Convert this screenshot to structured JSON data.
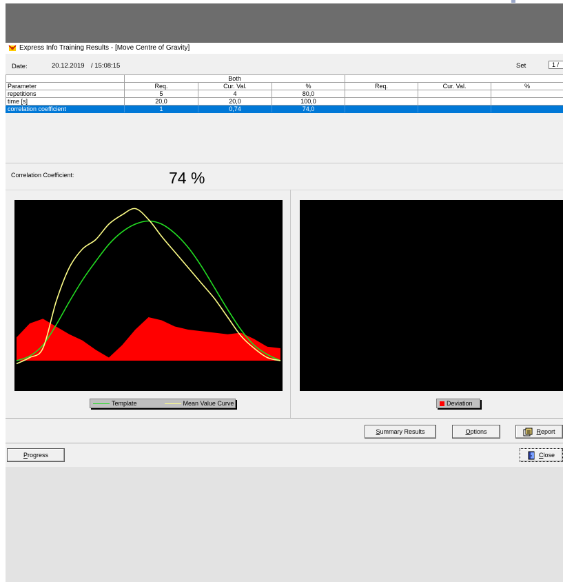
{
  "window": {
    "title": "Express Info Training Results - [Move Centre of Gravity]"
  },
  "info": {
    "date_label": "Date:",
    "date_value": "20.12.2019",
    "time_value": "/ 15:08:15",
    "set_label": "Set",
    "set_value": "1 /"
  },
  "table": {
    "group_headers": [
      "Both",
      ""
    ],
    "columns": [
      "Parameter",
      "Req.",
      "Cur. Val.",
      "%",
      "Req.",
      "Cur. Val.",
      "%"
    ],
    "rows": [
      {
        "cells": [
          "repetitions",
          "5",
          "4",
          "80,0",
          "",
          "",
          ""
        ],
        "selected": false
      },
      {
        "cells": [
          "time [s]",
          "20,0",
          "20,0",
          "100,0",
          "",
          "",
          ""
        ],
        "selected": false
      },
      {
        "cells": [
          "correlation coefficient",
          "1",
          "0,74",
          "74,0",
          "",
          "",
          ""
        ],
        "selected": true
      }
    ]
  },
  "correlation": {
    "label": "Correlation Coefficient:",
    "value": "74 %"
  },
  "legends": {
    "template": "Template",
    "mean": "Mean Value Curve",
    "deviation": "Deviation"
  },
  "colors": {
    "template": "#22dd22",
    "mean": "#ffff88",
    "deviation": "#ff0000",
    "chart_bg": "#000000",
    "selection": "#0078d7"
  },
  "chart_data": {
    "type": "line",
    "x": [
      0,
      5,
      10,
      15,
      20,
      25,
      30,
      35,
      40,
      45,
      50,
      55,
      60,
      65,
      70,
      75,
      80,
      85,
      90,
      95,
      100
    ],
    "series": [
      {
        "name": "Template",
        "values": [
          0.0,
          0.03,
          0.1,
          0.23,
          0.38,
          0.52,
          0.64,
          0.75,
          0.83,
          0.88,
          0.9,
          0.88,
          0.82,
          0.73,
          0.61,
          0.47,
          0.33,
          0.2,
          0.1,
          0.04,
          0.0
        ]
      },
      {
        "name": "Mean Value Curve",
        "values": [
          -0.02,
          0.02,
          0.08,
          0.38,
          0.6,
          0.72,
          0.78,
          0.88,
          0.94,
          0.98,
          0.91,
          0.8,
          0.7,
          0.6,
          0.5,
          0.4,
          0.28,
          0.16,
          0.08,
          0.02,
          0.0
        ]
      },
      {
        "name": "Deviation",
        "values": [
          0.15,
          0.24,
          0.27,
          0.22,
          0.17,
          0.13,
          0.07,
          0.02,
          0.1,
          0.2,
          0.28,
          0.26,
          0.22,
          0.2,
          0.19,
          0.18,
          0.17,
          0.18,
          0.14,
          0.09,
          0.08
        ]
      }
    ]
  },
  "buttons": {
    "summary": "Summary Results",
    "options": "Options",
    "report": "Report",
    "progress": "Progress",
    "close": "Close"
  }
}
